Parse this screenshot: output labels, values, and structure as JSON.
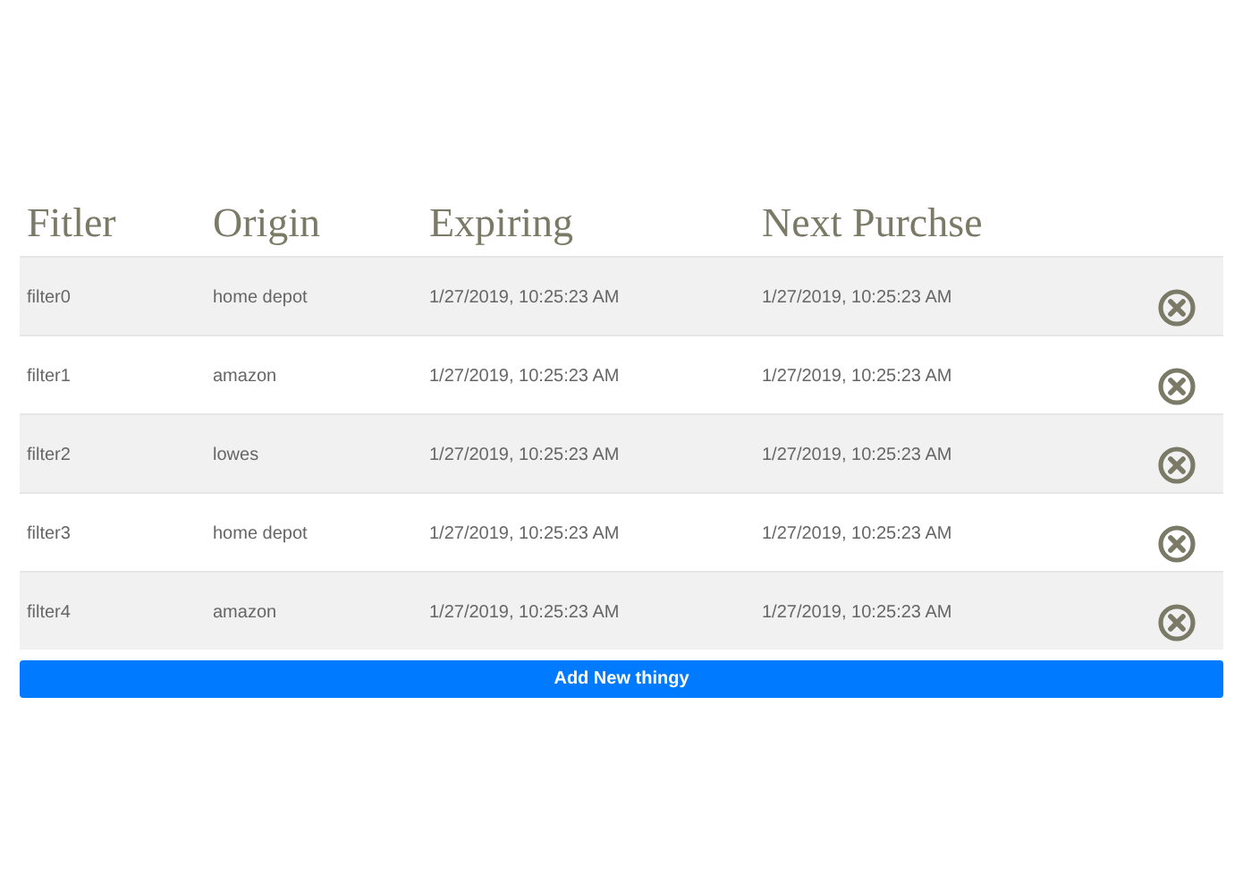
{
  "table": {
    "columns": [
      "Fitler",
      "Origin",
      "Expiring",
      "Next Purchse"
    ],
    "rows": [
      {
        "cells": [
          "filter0",
          "home depot",
          "1/27/2019, 10:25:23 AM",
          "1/27/2019, 10:25:23 AM"
        ]
      },
      {
        "cells": [
          "filter1",
          "amazon",
          "1/27/2019, 10:25:23 AM",
          "1/27/2019, 10:25:23 AM"
        ]
      },
      {
        "cells": [
          "filter2",
          "lowes",
          "1/27/2019, 10:25:23 AM",
          "1/27/2019, 10:25:23 AM"
        ]
      },
      {
        "cells": [
          "filter3",
          "home depot",
          "1/27/2019, 10:25:23 AM",
          "1/27/2019, 10:25:23 AM"
        ]
      },
      {
        "cells": [
          "filter4",
          "amazon",
          "1/27/2019, 10:25:23 AM",
          "1/27/2019, 10:25:23 AM"
        ]
      }
    ]
  },
  "add_button": "Add New thingy"
}
